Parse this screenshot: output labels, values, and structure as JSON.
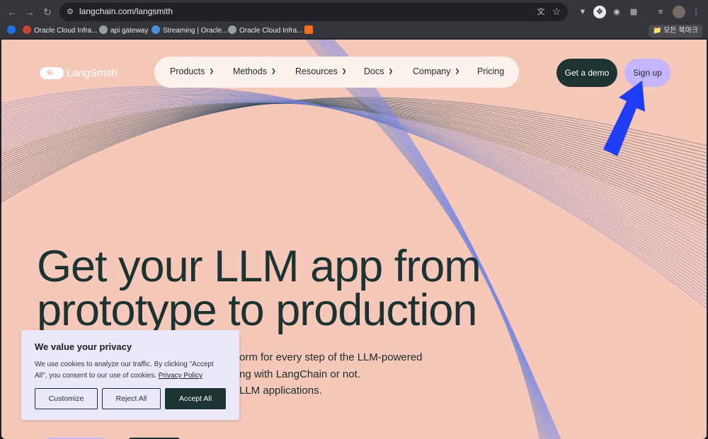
{
  "browser": {
    "url": "langchain.com/langsmith",
    "bookmarks": [
      {
        "label": "Oracle Cloud Infra..."
      },
      {
        "label": "api gateway"
      },
      {
        "label": "Streaming | Oracle..."
      },
      {
        "label": "Oracle Cloud Infra..."
      }
    ],
    "all_bookmarks_label": "모든 북마크"
  },
  "header": {
    "logo_text": "LangSmith",
    "nav": [
      {
        "label": "Products",
        "has_menu": true
      },
      {
        "label": "Methods",
        "has_menu": true
      },
      {
        "label": "Resources",
        "has_menu": true
      },
      {
        "label": "Docs",
        "has_menu": true
      },
      {
        "label": "Company",
        "has_menu": true
      },
      {
        "label": "Pricing",
        "has_menu": false
      }
    ],
    "get_demo_label": "Get a demo",
    "sign_up_label": "Sign up"
  },
  "hero": {
    "line1": "Get your LLM app from",
    "line2": "prototype to production",
    "sub_line1": "orm for every step of the LLM-powered",
    "sub_line2": "ng with LangChain or not.",
    "sub_line3": "LLM applications."
  },
  "cookie_banner": {
    "title": "We value your privacy",
    "body": "We use cookies to analyze our traffic. By clicking \"Accept All\", you consent to our use of cookies.",
    "policy_link": "Privacy Policy",
    "customize_label": "Customize",
    "reject_label": "Reject All",
    "accept_label": "Accept All"
  },
  "colors": {
    "page_bg": "#f5c8b9",
    "dark_green": "#1c3331",
    "lavender": "#c4b5fd",
    "arrow_blue": "#1f3df5"
  }
}
